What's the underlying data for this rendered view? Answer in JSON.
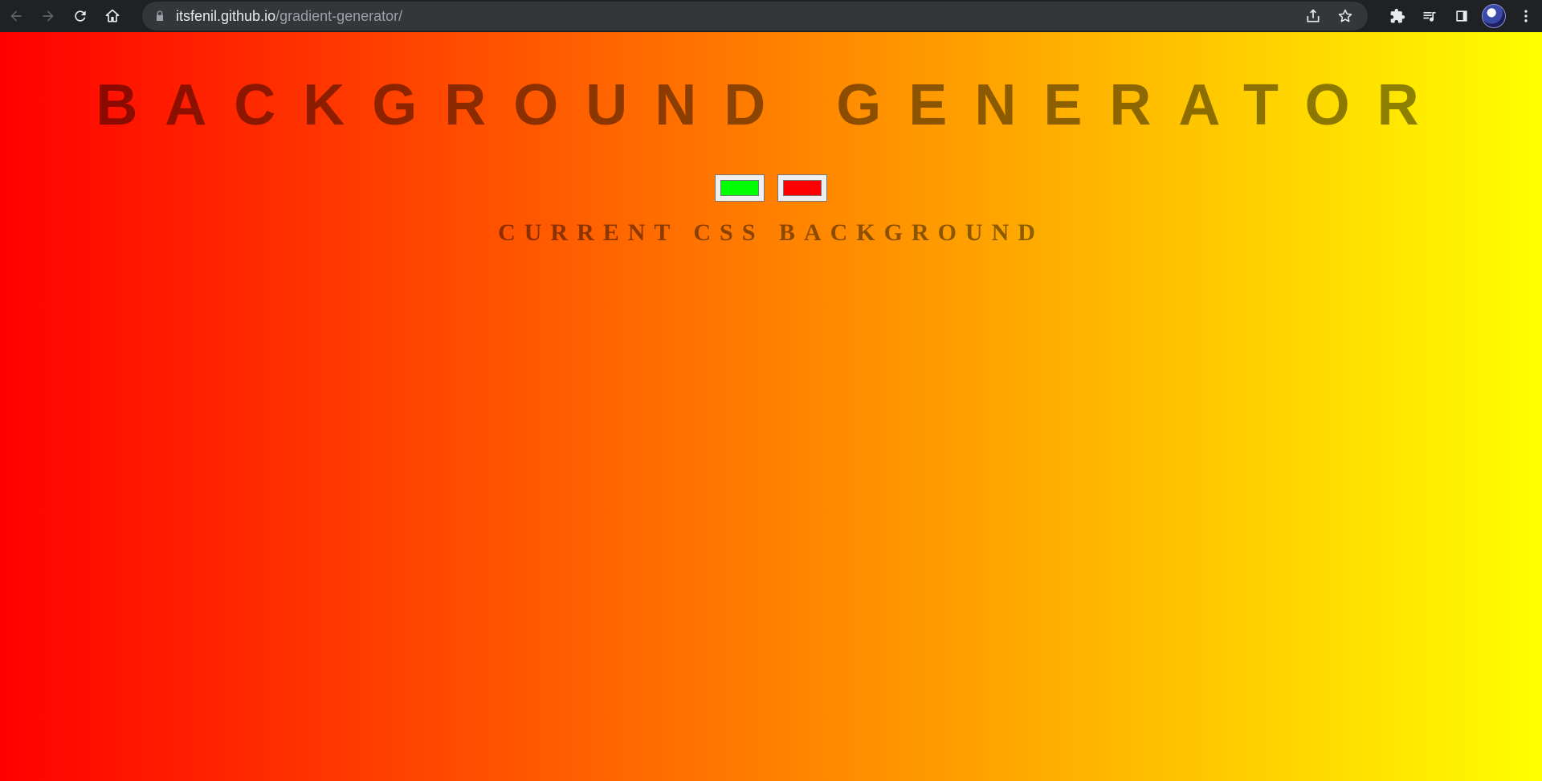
{
  "browser": {
    "url_host": "itsfenil.github.io",
    "url_path": "/gradient-generator/"
  },
  "page": {
    "title": "BACKGROUND GENERATOR",
    "color1": "#00ff00",
    "color2": "#ff0000",
    "css_label": "CURRENT CSS BACKGROUND",
    "background_from": "#ff0000",
    "background_to": "#ffff00"
  }
}
